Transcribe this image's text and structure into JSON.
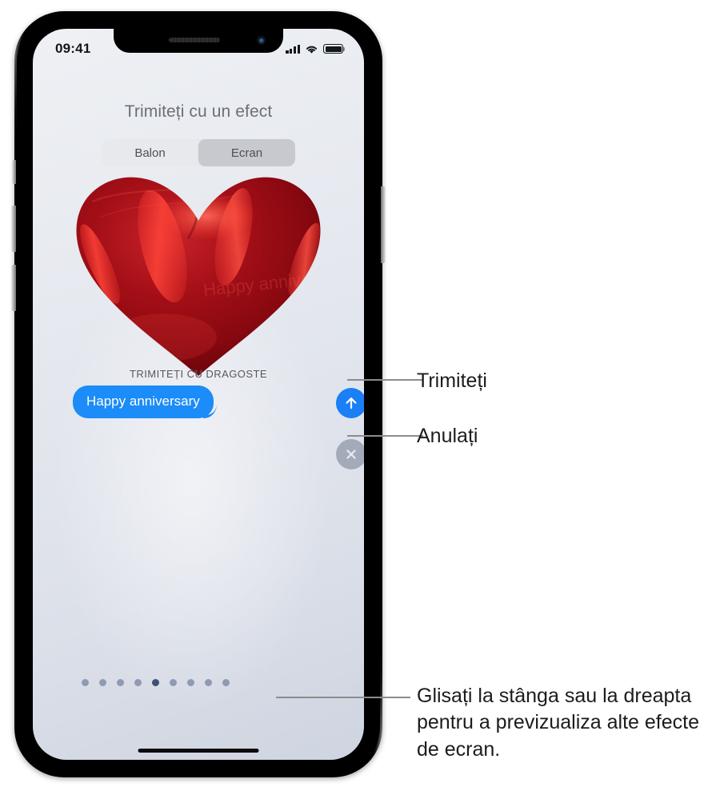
{
  "status_bar": {
    "time": "09:41",
    "signal_icon": "cellular-signal-icon",
    "wifi_icon": "wifi-icon",
    "battery_icon": "battery-icon"
  },
  "screen": {
    "sheet_title": "Trimiteți cu un efect",
    "segmented_control": {
      "options": [
        {
          "label": "Balon",
          "selected": false
        },
        {
          "label": "Ecran",
          "selected": true
        }
      ]
    },
    "effect": {
      "name": "heart-balloon-graphic",
      "caption": "TRIMITEȚI CU DRAGOSTE",
      "color": "#b01118"
    },
    "message_bubble": {
      "text": "Happy anniversary",
      "color": "#1b8cf8"
    },
    "send_button": {
      "icon": "arrow-up-icon",
      "color": "#1b7ff5"
    },
    "cancel_button": {
      "icon": "close-x-icon",
      "color": "#a3abba"
    },
    "page_dots": {
      "count": 9,
      "active_index": 4,
      "active_color": "#3c5174",
      "inactive_color": "#8e9bb4"
    }
  },
  "callouts": [
    {
      "label": "Trimiteți"
    },
    {
      "label": "Anulați"
    },
    {
      "label": "Glisați la stânga sau la dreapta pentru a previzualiza alte efecte de ecran."
    }
  ]
}
